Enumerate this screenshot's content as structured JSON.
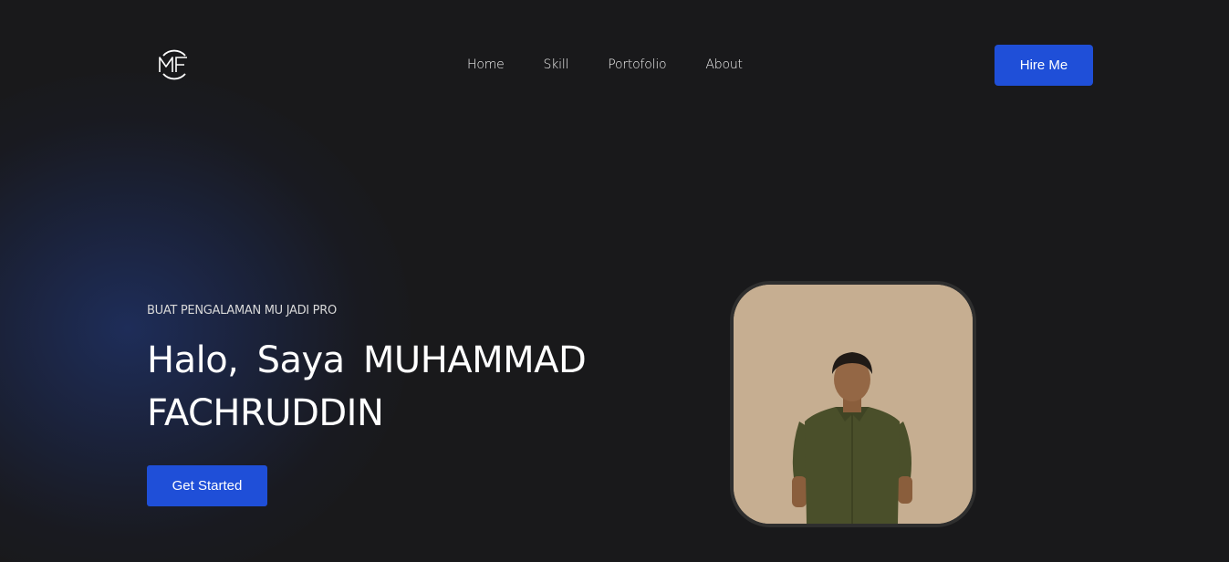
{
  "header": {
    "logo_text": "MF",
    "nav": [
      {
        "label": "Home"
      },
      {
        "label": "Skill"
      },
      {
        "label": "Portofolio"
      },
      {
        "label": "About"
      }
    ],
    "hire_label": "Hire Me"
  },
  "hero": {
    "tagline": "BUAT PENGALAMAN MU JADI PRO",
    "greeting": "Halo, Saya",
    "name_line1": "MUHAMMAD",
    "name_line2": "FACHRUDDIN",
    "cta_label": "Get Started"
  },
  "colors": {
    "background": "#19191b",
    "accent": "#1f4fd8",
    "photo_bg": "#c6ae91",
    "shirt": "#4a4f2a"
  },
  "icons": {
    "logo": "mf-monogram-logo",
    "photo": "profile-photo"
  }
}
